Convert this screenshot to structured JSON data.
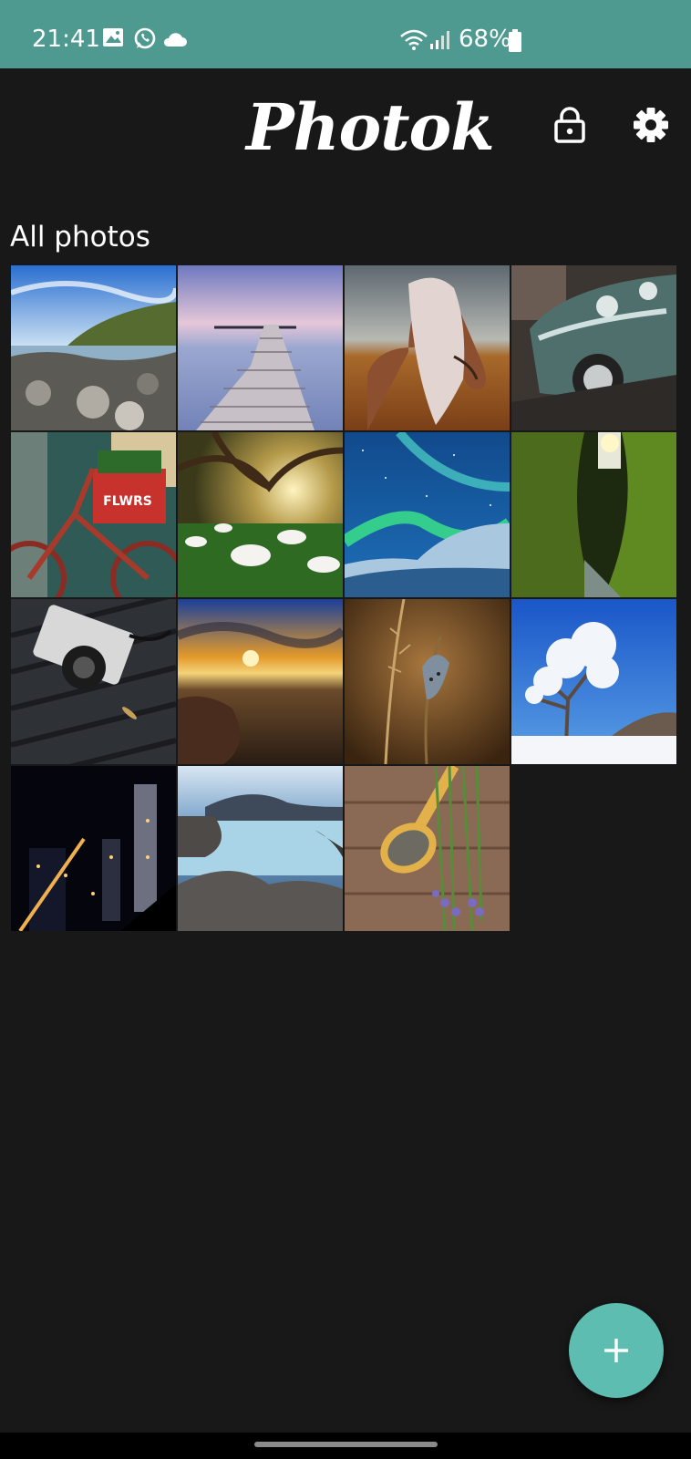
{
  "status_bar": {
    "time": "21:41",
    "battery": "68%",
    "left_icons": [
      "gallery-icon",
      "whatsapp-icon",
      "cloud-icon"
    ],
    "right_icons": [
      "wifi-icon",
      "signal-icon",
      "battery-icon"
    ],
    "background_color": "#4f9a90"
  },
  "header": {
    "title": "Photok",
    "actions": [
      {
        "name": "lock-button",
        "icon": "lock-icon"
      },
      {
        "name": "settings-button",
        "icon": "gear-icon"
      }
    ]
  },
  "gallery": {
    "section_title": "All photos",
    "photos": [
      {
        "subject": "rocky coastline"
      },
      {
        "subject": "wooden pier at dusk"
      },
      {
        "subject": "horse with long mane"
      },
      {
        "subject": "vintage car"
      },
      {
        "subject": "red bicycle with flower crate"
      },
      {
        "subject": "calla lilies under tree"
      },
      {
        "subject": "northern lights"
      },
      {
        "subject": "mossy canyon"
      },
      {
        "subject": "camera on bench"
      },
      {
        "subject": "sunset over sea"
      },
      {
        "subject": "butterfly on grass"
      },
      {
        "subject": "frosted tree"
      },
      {
        "subject": "city skyline at night"
      },
      {
        "subject": "misty rocky shore"
      },
      {
        "subject": "lavender and wooden spoon"
      }
    ]
  },
  "fab": {
    "icon": "plus-icon",
    "color": "#5dbdb1"
  },
  "colors": {
    "background": "#181818",
    "accent": "#5dbdb1"
  }
}
